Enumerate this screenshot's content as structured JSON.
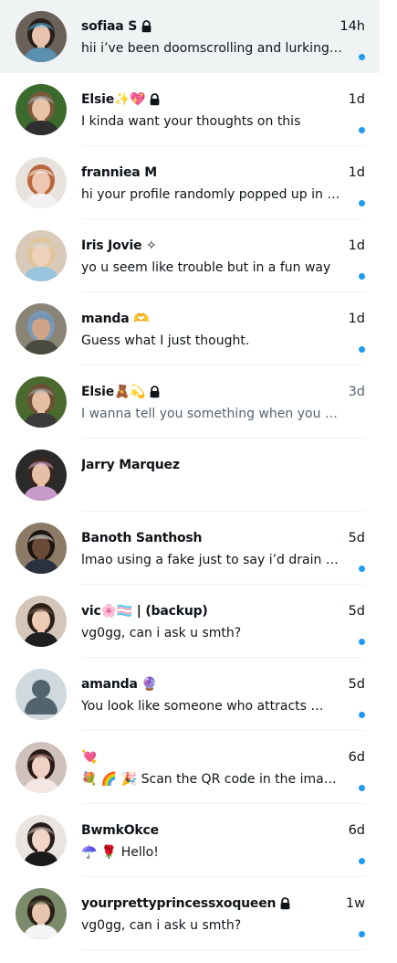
{
  "colors": {
    "unread_dot": "#1d9bf0",
    "muted_text": "#536471",
    "primary_text": "#0f1419",
    "selected_row": "#eff3f4",
    "divider": "#eff3f4"
  },
  "conversations": [
    {
      "name": "sofiaa S",
      "locked": true,
      "time": "14h",
      "preview": "hii i’ve been doomscrolling and lurking …",
      "unread": true,
      "selected": true,
      "avatar_icon": "avatar-photo"
    },
    {
      "name": "Elsie✨💖",
      "locked": true,
      "time": "1d",
      "preview": "I kinda want your thoughts on this",
      "unread": true,
      "selected": false,
      "avatar_icon": "avatar-photo"
    },
    {
      "name": "franniea M",
      "locked": false,
      "time": "1d",
      "preview": "hi your profile randomly popped up in …",
      "unread": true,
      "selected": false,
      "avatar_icon": "avatar-photo"
    },
    {
      "name": "Iris Jovie ✧",
      "locked": false,
      "time": "1d",
      "preview": "yo u seem like trouble but in a fun way",
      "unread": true,
      "selected": false,
      "avatar_icon": "avatar-photo"
    },
    {
      "name": "manda 🫶",
      "locked": false,
      "time": "1d",
      "preview": "Guess what I just thought.",
      "unread": true,
      "selected": false,
      "avatar_icon": "avatar-photo"
    },
    {
      "name": "Elsie🧸💫",
      "locked": true,
      "time": "3d",
      "preview": "I wanna tell you something when you are …",
      "unread": false,
      "selected": false,
      "avatar_icon": "avatar-photo"
    },
    {
      "name": "Jarry Marquez",
      "locked": false,
      "time": "",
      "preview": "",
      "unread": false,
      "selected": false,
      "avatar_icon": "avatar-photo"
    },
    {
      "name": "Banoth Santhosh",
      "locked": false,
      "time": "5d",
      "preview": "lmao using a fake just to say i’d drain y…",
      "unread": true,
      "selected": false,
      "avatar_icon": "avatar-photo"
    },
    {
      "name": "vic🌸🏳️‍⚧️ | (backup)",
      "locked": false,
      "time": "5d",
      "preview": "vg0gg, can i ask u smth?",
      "unread": true,
      "selected": false,
      "avatar_icon": "avatar-photo"
    },
    {
      "name": "amanda 🔮",
      "locked": false,
      "time": "5d",
      "preview": "You look like someone who attracts …",
      "unread": true,
      "selected": false,
      "avatar_icon": "default-avatar-icon"
    },
    {
      "name": "💘",
      "locked": false,
      "time": "6d",
      "preview": "💐 🌈 🎉 Scan the QR code in the ima…",
      "unread": true,
      "selected": false,
      "avatar_icon": "avatar-photo"
    },
    {
      "name": "BwmkOkce",
      "locked": false,
      "time": "6d",
      "preview": "☂️ 🌹 Hello!",
      "unread": true,
      "selected": false,
      "avatar_icon": "avatar-photo"
    },
    {
      "name": "yourprettyprincessxoqueen",
      "locked": true,
      "time": "1w",
      "preview": "vg0gg, can i ask u smth?",
      "unread": true,
      "selected": false,
      "avatar_icon": "avatar-photo"
    }
  ]
}
